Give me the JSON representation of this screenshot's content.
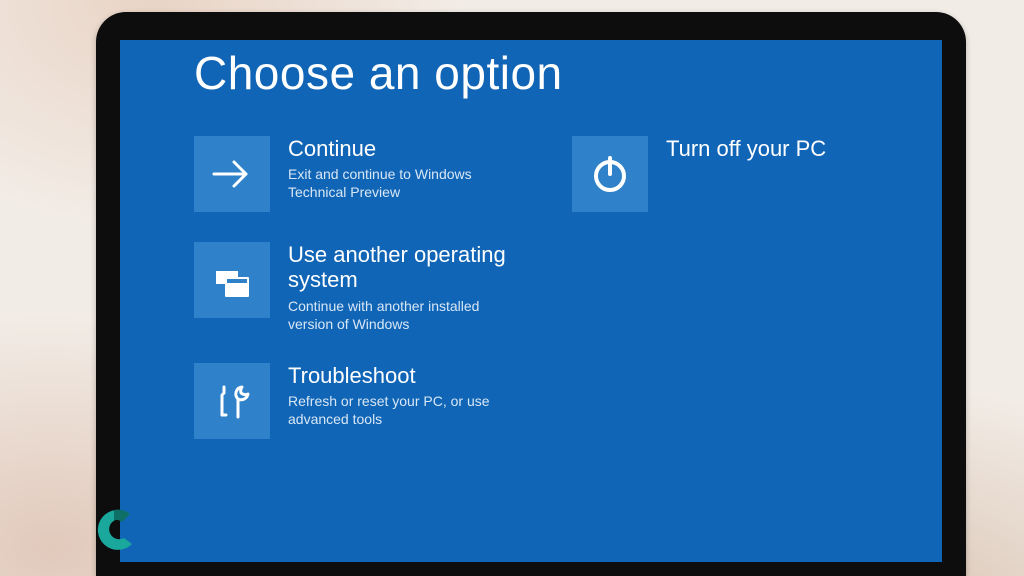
{
  "title": "Choose an option",
  "options": {
    "continue": {
      "label": "Continue",
      "desc": "Exit and continue to Windows Technical Preview"
    },
    "other_os": {
      "label": "Use another operating system",
      "desc": "Continue with another installed version of Windows"
    },
    "trouble": {
      "label": "Troubleshoot",
      "desc": "Refresh or reset your PC, or use advanced tools"
    },
    "power_off": {
      "label": "Turn off your PC",
      "desc": ""
    }
  },
  "colors": {
    "screen": "#1165b6",
    "tile": "#2f81c9"
  }
}
